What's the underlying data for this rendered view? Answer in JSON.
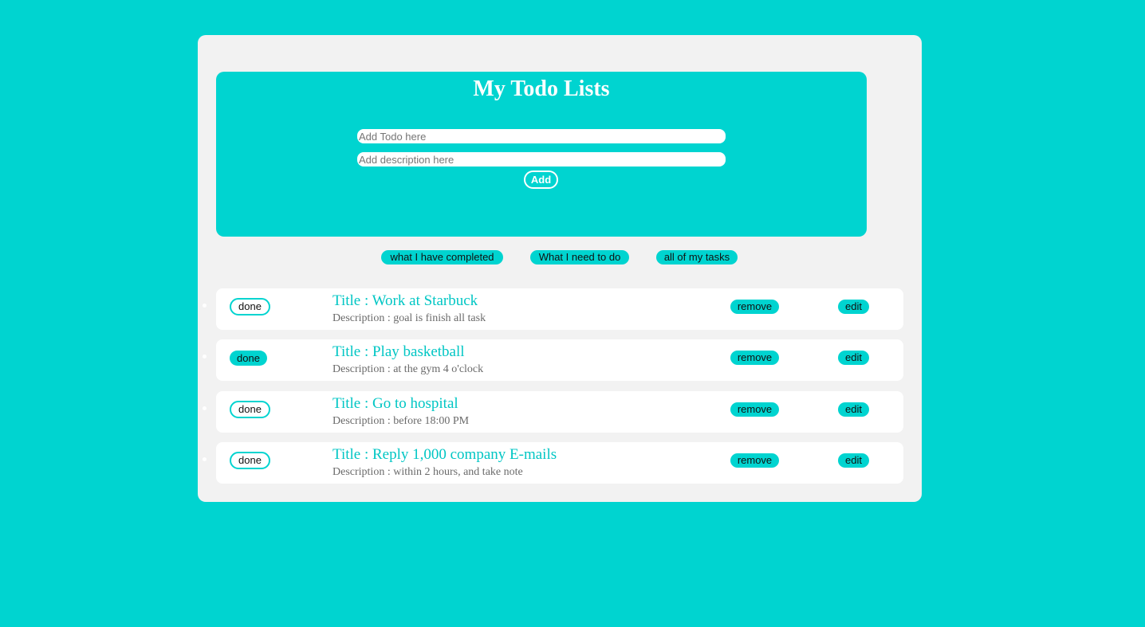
{
  "header": {
    "title": "My Todo Lists",
    "todo_placeholder": "Add Todo here",
    "description_placeholder": "Add description here",
    "add_label": "Add"
  },
  "filters": {
    "completed_label": "what I have completed",
    "need_to_do_label": "What I need to do",
    "all_label": "all of my tasks"
  },
  "todos": [
    {
      "done_label": "done",
      "done": false,
      "title": "Title : Work at Starbuck",
      "description": "Description : goal is finish all task",
      "remove_label": "remove",
      "edit_label": "edit"
    },
    {
      "done_label": "done",
      "done": true,
      "title": "Title : Play basketball",
      "description": "Description : at the gym 4 o'clock",
      "remove_label": "remove",
      "edit_label": "edit"
    },
    {
      "done_label": "done",
      "done": false,
      "title": "Title : Go to hospital",
      "description": "Description : before 18:00 PM",
      "remove_label": "remove",
      "edit_label": "edit"
    },
    {
      "done_label": "done",
      "done": false,
      "title": "Title : Reply 1,000 company E-mails",
      "description": "Description : within 2 hours, and take note",
      "remove_label": "remove",
      "edit_label": "edit"
    }
  ],
  "colors": {
    "accent": "#00d4d0",
    "panel": "#f2f2f2",
    "card": "#ffffff",
    "title_text": "#00c6c4",
    "description_text": "#6a6a6a"
  }
}
